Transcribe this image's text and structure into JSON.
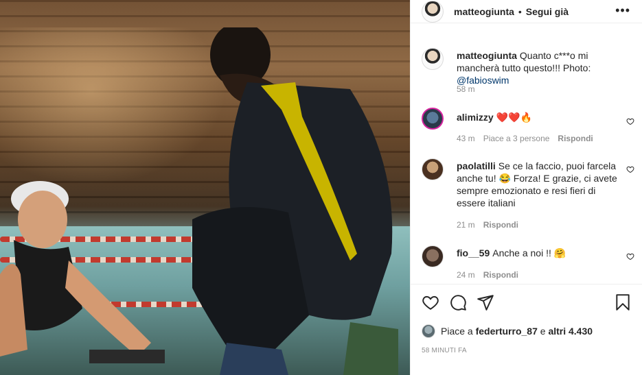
{
  "post": {
    "username": "matteogiunta",
    "follow_status": "Segui già",
    "more_label": "•••"
  },
  "comments": [
    {
      "username": "matteogiunta",
      "text_before": "Quanto c***o mi mancherà tutto questo!!! Photo: ",
      "mention": "@fabioswim",
      "time": "58 m"
    },
    {
      "username": "alimizzy",
      "text": "❤️❤️🔥",
      "time": "43 m",
      "likes": "Piace a 3 persone",
      "reply": "Rispondi"
    },
    {
      "username": "paolatilli",
      "text": "Se ce la faccio, puoi farcela anche tu! 😂 Forza! E grazie, ci avete sempre emozionato e resi fieri di essere italiani",
      "time": "21 m",
      "reply": "Rispondi"
    },
    {
      "username": "fio__59",
      "text": "Anche a noi !! 🤗",
      "time": "24 m",
      "reply": "Rispondi"
    }
  ],
  "likes_line": {
    "prefix": "Piace a ",
    "user": "federturro_87",
    "middle": " e ",
    "others": "altri 4.430"
  },
  "time_ago": "58 MINUTI FA",
  "icons": [
    "heart-icon",
    "comment-icon",
    "share-icon",
    "bookmark-icon",
    "more-icon",
    "heart-outline-icon"
  ]
}
